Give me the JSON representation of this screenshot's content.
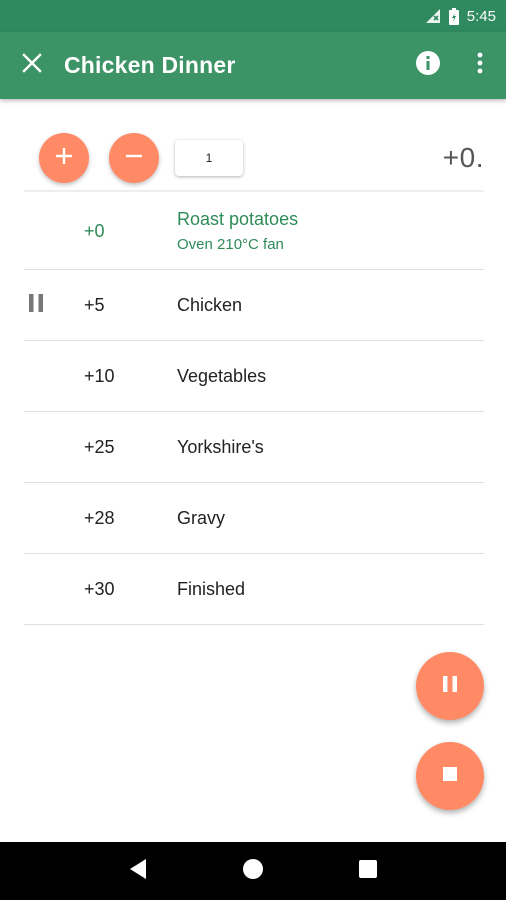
{
  "status_bar": {
    "time": "5:45"
  },
  "app_bar": {
    "title": "Chicken Dinner"
  },
  "controls": {
    "quantity": "1",
    "offset_display": "+0."
  },
  "steps": [
    {
      "offset": "+0",
      "name": "Roast potatoes",
      "subtitle": "Oven 210°C fan",
      "active": true
    },
    {
      "offset": "+5",
      "name": "Chicken",
      "paused": true
    },
    {
      "offset": "+10",
      "name": "Vegetables"
    },
    {
      "offset": "+25",
      "name": "Yorkshire's"
    },
    {
      "offset": "+28",
      "name": "Gravy"
    },
    {
      "offset": "+30",
      "name": "Finished"
    }
  ],
  "colors": {
    "app_bar": "#3b9366",
    "status_bar": "#2f8a5f",
    "accent": "#ff8a65",
    "active_text": "#2e8b57"
  },
  "icons": [
    "close-icon",
    "info-icon",
    "more-vert-icon",
    "add-icon",
    "remove-icon",
    "pause-icon",
    "stop-icon",
    "back-icon",
    "home-icon",
    "recents-icon",
    "no-signal-icon",
    "battery-icon"
  ]
}
